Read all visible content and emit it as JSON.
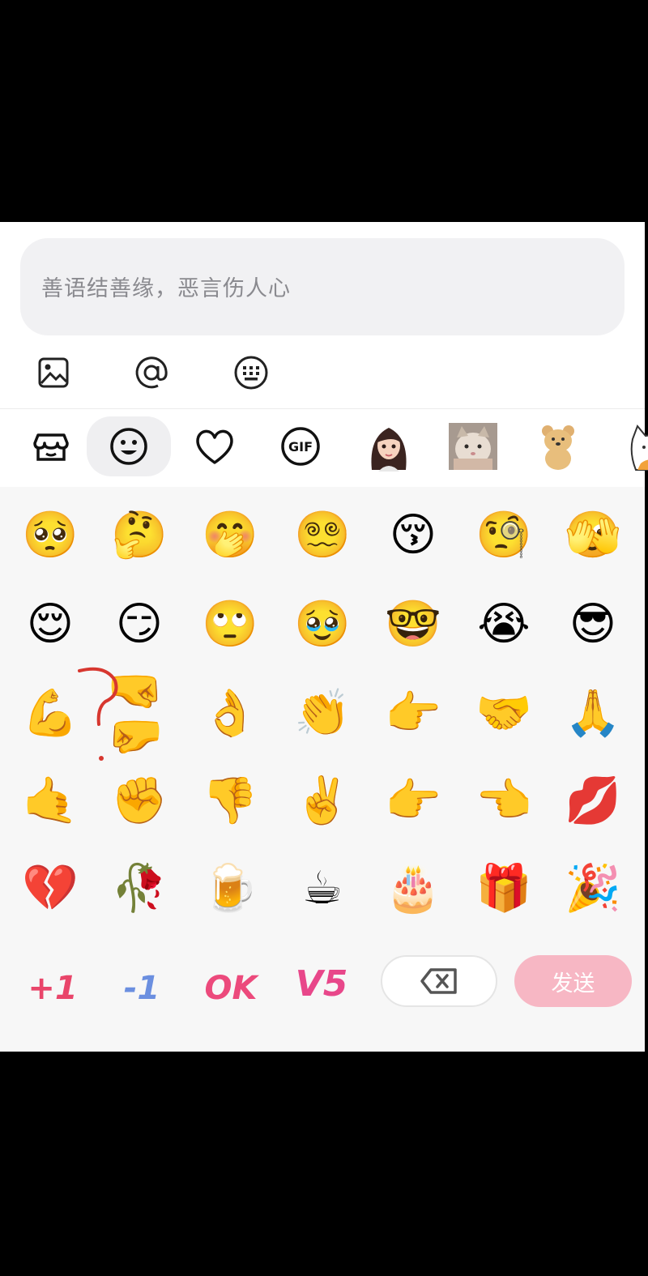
{
  "input": {
    "placeholder": "善语结善缘，恶言伤人心"
  },
  "toolbar": {
    "icons": [
      "image-icon",
      "mention-icon",
      "keyboard-icon"
    ]
  },
  "tabs": {
    "icons": [
      "sticker-shop-icon",
      "smiley-icon",
      "heart-icon",
      "gif-icon",
      "avatar-girl-icon",
      "cat-photo-icon",
      "bear-sticker-icon",
      "cat-sticker-icon"
    ],
    "active": "smiley-icon",
    "gif_label": "GIF"
  },
  "emoji_rows": [
    [
      "🥺",
      "🤔",
      "🤭",
      "😵‍💫",
      "😚",
      "🧐",
      "🫣"
    ],
    [
      "😌",
      "😏",
      "🙄",
      "🥹",
      "🤓",
      "😭",
      "😎"
    ],
    [
      "💪",
      "🤜🤛",
      "👌",
      "👏",
      "👉",
      "🤝",
      "🙏"
    ],
    [
      "🤙",
      "✊",
      "👎",
      "✌️",
      "👉",
      "👈",
      "💋"
    ],
    [
      "💔",
      "🥀",
      "🍺",
      "☕",
      "🎂",
      "🎁",
      "🎉"
    ]
  ],
  "stickers": [
    "+1",
    "-1",
    "OK",
    "V5"
  ],
  "actions": {
    "send_label": "发送"
  },
  "colors": {
    "accent_pink": "#f7b7c4",
    "input_bg": "#f1f1f3",
    "grid_bg": "#f7f7f7"
  }
}
